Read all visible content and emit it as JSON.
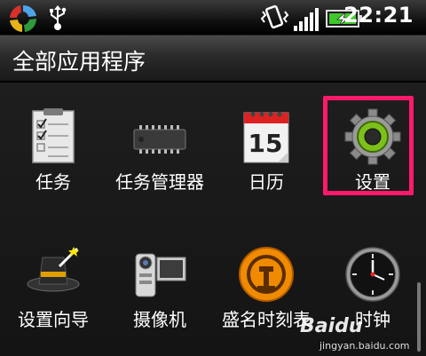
{
  "status_bar": {
    "time": "22:21",
    "icons": [
      "app-logo-icon",
      "usb-icon",
      "vibrate-icon",
      "signal-icon",
      "battery-charging-icon"
    ]
  },
  "title": "全部应用程序",
  "apps": [
    {
      "label": "任务",
      "icon": "task-list-icon"
    },
    {
      "label": "任务管理器",
      "icon": "chip-icon"
    },
    {
      "label": "日历",
      "icon": "calendar-icon",
      "calendar_day": "15"
    },
    {
      "label": "设置",
      "icon": "settings-gear-icon",
      "highlighted": true
    },
    {
      "label": "设置向导",
      "icon": "magic-hat-icon"
    },
    {
      "label": "摄像机",
      "icon": "camcorder-icon"
    },
    {
      "label": "盛名时刻表",
      "icon": "railway-icon"
    },
    {
      "label": "时钟",
      "icon": "clock-icon"
    }
  ],
  "colors": {
    "highlight": "#ff1a6c",
    "accent_green": "#7dc01c"
  },
  "watermark": {
    "brand": "Baidu",
    "url": "jingyan.baidu.com"
  }
}
